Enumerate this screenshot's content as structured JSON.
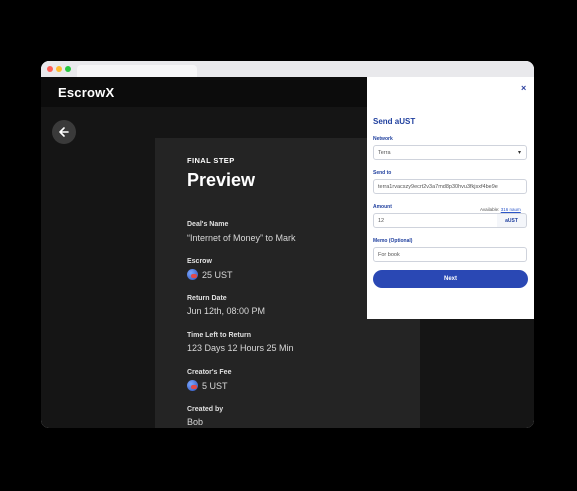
{
  "app": {
    "logo": "EscrowX",
    "colors": {
      "accent": "#2a48b4",
      "background": "#151515",
      "card": "#242424"
    }
  },
  "preview": {
    "step": "FINAL STEP",
    "title": "Preview",
    "fields": [
      {
        "label": "Deal's Name",
        "value": "“Internet of Money” to Mark"
      },
      {
        "label": "Escrow",
        "value": "25 UST"
      },
      {
        "label": "Return Date",
        "value": "Jun 12th, 08:00 PM"
      },
      {
        "label": "Time Left to Return",
        "value": "123 Days 12 Hours 25 Min"
      },
      {
        "label": "Creator's Fee",
        "value": "5 UST"
      },
      {
        "label": "Created by",
        "value": "Bob"
      }
    ]
  },
  "send": {
    "title": "Send aUST",
    "close_icon": "×",
    "network_label": "Network",
    "network_value": "Terra",
    "sendto_label": "Send to",
    "sendto_value": "terra1rvacszy9ecrt2v3a7md8p30hvu3fkjsxf4be9e",
    "amount_label": "Amount",
    "available_label": "Available:",
    "available_value": "316 naum",
    "amount_value": "12",
    "amount_unit": "aUST",
    "memo_label": "Memo (Optional)",
    "memo_value": "For book",
    "next_label": "Next"
  }
}
